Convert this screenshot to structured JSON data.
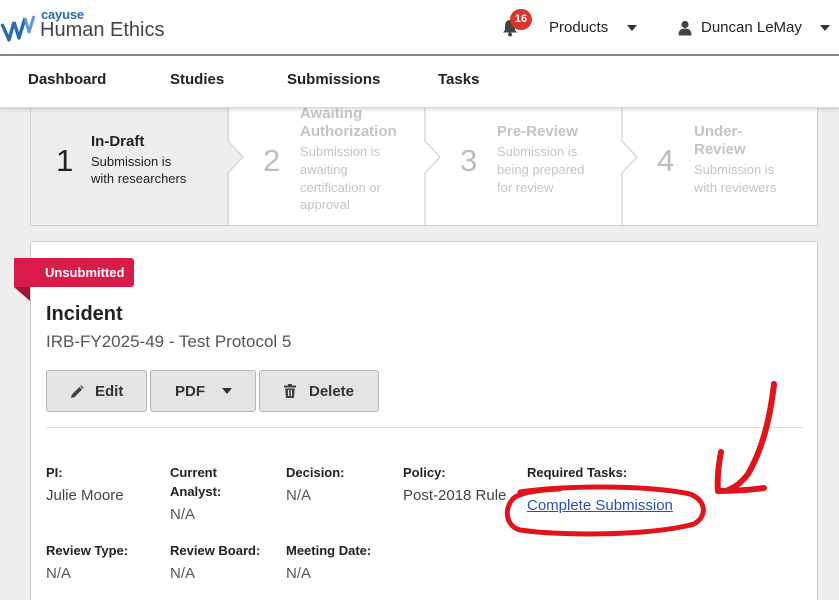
{
  "header": {
    "logo_small": "cayuse",
    "logo_big": "Human Ethics",
    "notification_count": "16",
    "products_label": "Products",
    "user_name": "Duncan LeMay"
  },
  "nav": {
    "items": [
      "Dashboard",
      "Studies",
      "Submissions",
      "Tasks"
    ]
  },
  "stepper": {
    "steps": [
      {
        "num": "1",
        "title": "In-Draft",
        "desc_lines": [
          "Submission is",
          "with researchers"
        ]
      },
      {
        "num": "2",
        "title_lines": [
          "Awaiting",
          "Authorization"
        ],
        "desc_lines": [
          "Submission is",
          "awaiting",
          "certification or",
          "approval"
        ]
      },
      {
        "num": "3",
        "title": "Pre-Review",
        "desc_lines": [
          "Submission is",
          "being prepared",
          "for review"
        ]
      },
      {
        "num": "4",
        "title_lines": [
          "Under-",
          "Review"
        ],
        "desc_lines": [
          "Submission is",
          "with reviewers"
        ]
      }
    ]
  },
  "card": {
    "status": "Unsubmitted",
    "title": "Incident",
    "subtitle": "IRB-FY2025-49 - Test Protocol 5",
    "buttons": {
      "edit": "Edit",
      "pdf": "PDF",
      "delete": "Delete"
    },
    "fields": {
      "pi_label": "PI:",
      "pi_value": "Julie Moore",
      "analyst_label_1": "Current",
      "analyst_label_2": "Analyst:",
      "analyst_value": "N/A",
      "decision_label": "Decision:",
      "decision_value": "N/A",
      "policy_label": "Policy:",
      "policy_value": "Post-2018 Rule",
      "tasks_label": "Required Tasks:",
      "tasks_link": "Complete Submission",
      "review_type_label": "Review Type:",
      "review_type_value": "N/A",
      "review_board_label": "Review Board:",
      "review_board_value": "N/A",
      "meeting_date_label": "Meeting Date:",
      "meeting_date_value": "N/A"
    }
  },
  "colors": {
    "brand_blue": "#2a6bb0",
    "badge_red": "#d9352b",
    "ribbon_red": "#d81b4b",
    "link_blue": "#2550b8",
    "annotation_red": "#e0141a"
  },
  "icons": [
    "cayuse-logo-icon",
    "bell-icon",
    "caret-down-icon",
    "user-icon",
    "pencil-icon",
    "trash-icon",
    "chevron-right-icon"
  ]
}
